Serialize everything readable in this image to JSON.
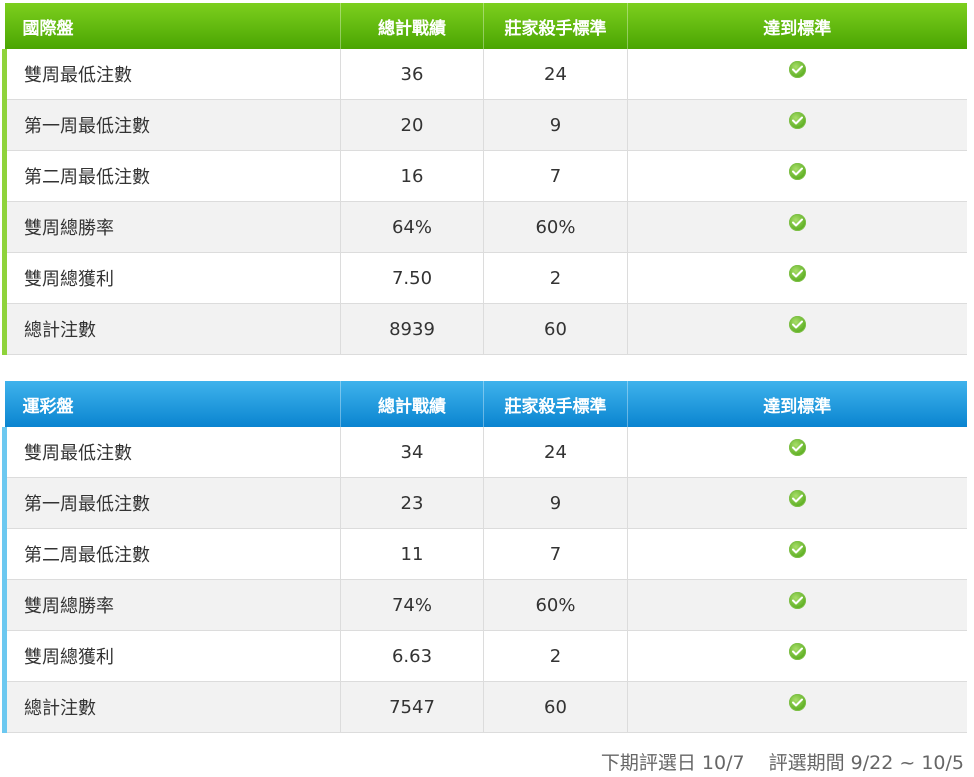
{
  "tables": [
    {
      "title": "國際盤",
      "theme_color": "#5cb90a",
      "headers": [
        "總計戰績",
        "莊家殺手標準",
        "達到標準"
      ],
      "rows": [
        {
          "label": "雙周最低注數",
          "total": "36",
          "standard": "24"
        },
        {
          "label": "第一周最低注數",
          "total": "20",
          "standard": "9"
        },
        {
          "label": "第二周最低注數",
          "total": "16",
          "standard": "7"
        },
        {
          "label": "雙周總勝率",
          "total": "64%",
          "standard": "60%"
        },
        {
          "label": "雙周總獲利",
          "total": "7.50",
          "standard": "2"
        },
        {
          "label": "總計注數",
          "total": "8939",
          "standard": "60"
        }
      ]
    },
    {
      "title": "運彩盤",
      "theme_color": "#1a97dc",
      "headers": [
        "總計戰績",
        "莊家殺手標準",
        "達到標準"
      ],
      "rows": [
        {
          "label": "雙周最低注數",
          "total": "34",
          "standard": "24"
        },
        {
          "label": "第一周最低注數",
          "total": "23",
          "standard": "9"
        },
        {
          "label": "第二周最低注數",
          "total": "11",
          "standard": "7"
        },
        {
          "label": "雙周總勝率",
          "total": "74%",
          "standard": "60%"
        },
        {
          "label": "雙周總獲利",
          "total": "6.63",
          "standard": "2"
        },
        {
          "label": "總計注數",
          "total": "7547",
          "standard": "60"
        }
      ]
    }
  ],
  "status_icon": "check-circle-icon",
  "footer": {
    "next_selection": "下期評選日 10/7",
    "selection_period": "評選期間 9/22 ~ 10/5"
  }
}
